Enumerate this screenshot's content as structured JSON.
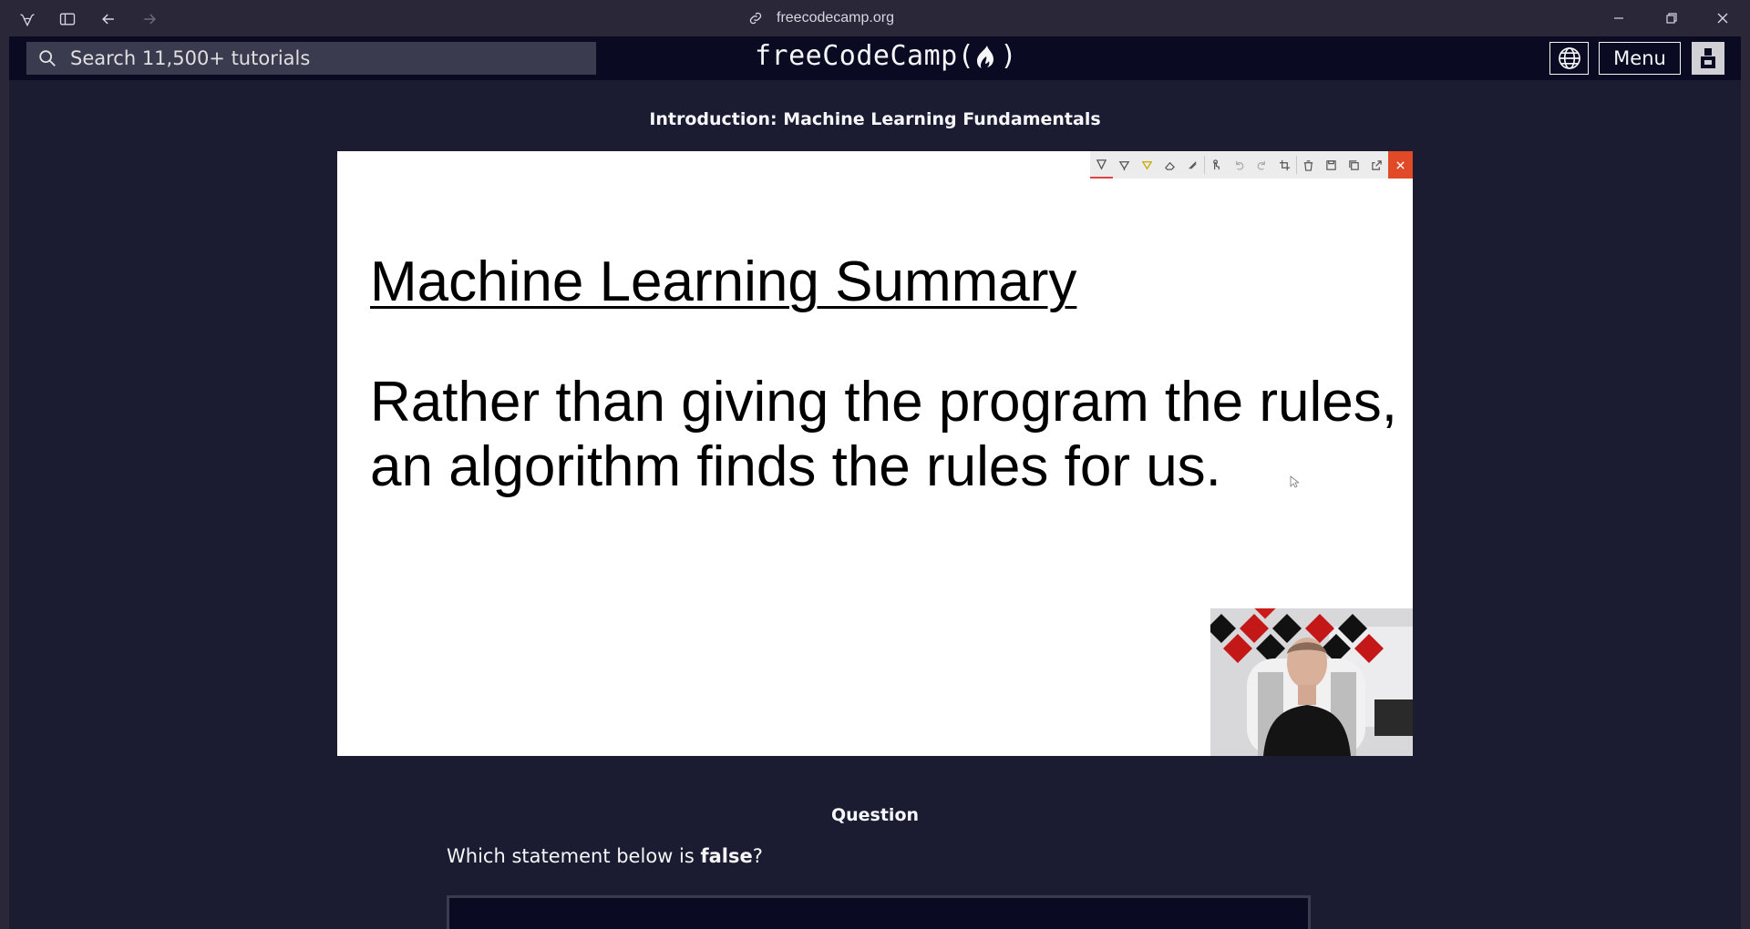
{
  "browser": {
    "url": "freecodecamp.org"
  },
  "header": {
    "search_placeholder": "Search 11,500+ tutorials",
    "brand_left": "freeCodeCamp(",
    "brand_right": ")",
    "menu_label": "Menu"
  },
  "lesson": {
    "title": "Introduction: Machine Learning Fundamentals"
  },
  "slide": {
    "title": "Machine Learning Summary",
    "body_line1": "Rather than giving the program the rules,",
    "body_line2": "an algorithm finds the rules for us."
  },
  "question": {
    "heading": "Question",
    "text_prefix": "Which statement below is ",
    "text_emphasis": "false",
    "text_suffix": "?"
  },
  "colors": {
    "navbar": "#0a0a23",
    "background": "#1b1b32",
    "accent_close": "#e04a26"
  }
}
